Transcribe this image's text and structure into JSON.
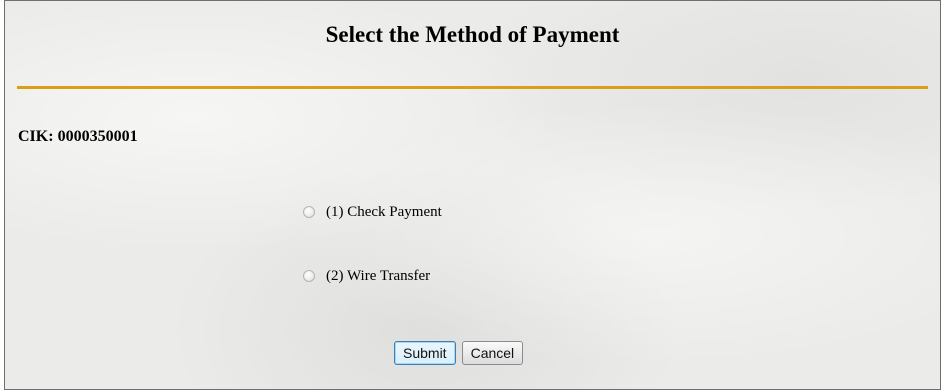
{
  "page": {
    "title": "Select the Method of Payment",
    "cik_label": "CIK:",
    "cik_value": "0000350001"
  },
  "payment_options": [
    {
      "label": "(1) Check Payment",
      "selected": false
    },
    {
      "label": "(2) Wire Transfer",
      "selected": false
    }
  ],
  "buttons": {
    "submit_label": "Submit",
    "cancel_label": "Cancel"
  },
  "colors": {
    "rule": "#d9a017",
    "background": "#ebebe9",
    "submit_border": "#3c7fb1"
  }
}
